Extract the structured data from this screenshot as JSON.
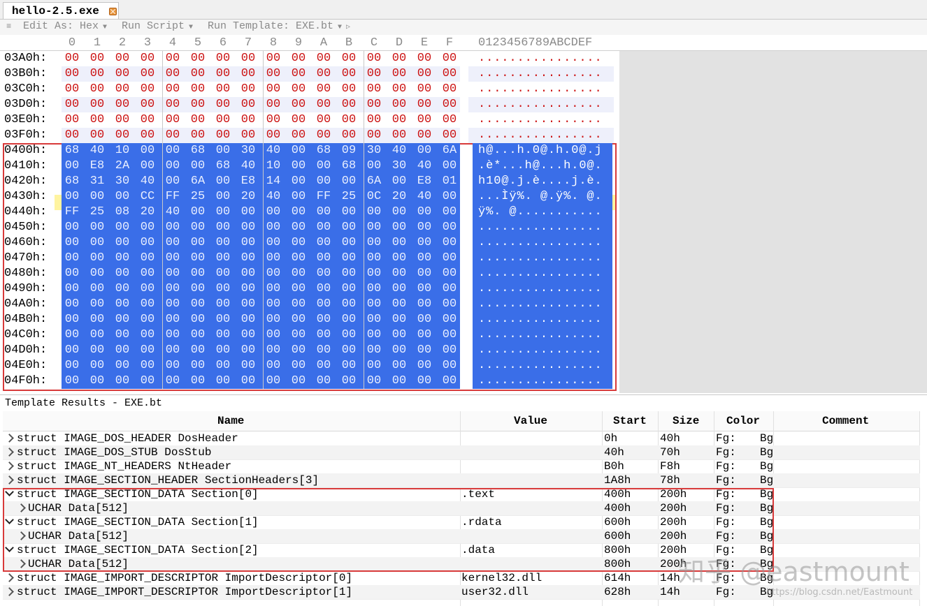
{
  "tab": {
    "label": "hello-2.5.exe"
  },
  "toolbar": {
    "edit_as": "Edit As: Hex",
    "run_script": "Run Script",
    "run_template": "Run Template: EXE.bt"
  },
  "hex": {
    "col_headers": [
      "0",
      "1",
      "2",
      "3",
      "4",
      "5",
      "6",
      "7",
      "8",
      "9",
      "A",
      "B",
      "C",
      "D",
      "E",
      "F"
    ],
    "ascii_header": "0123456789ABCDEF",
    "rows": [
      {
        "offset": "03A0h:",
        "bytes": [
          "00",
          "00",
          "00",
          "00",
          "00",
          "00",
          "00",
          "00",
          "00",
          "00",
          "00",
          "00",
          "00",
          "00",
          "00",
          "00"
        ],
        "ascii": "................",
        "selected": false
      },
      {
        "offset": "03B0h:",
        "bytes": [
          "00",
          "00",
          "00",
          "00",
          "00",
          "00",
          "00",
          "00",
          "00",
          "00",
          "00",
          "00",
          "00",
          "00",
          "00",
          "00"
        ],
        "ascii": "................",
        "selected": false
      },
      {
        "offset": "03C0h:",
        "bytes": [
          "00",
          "00",
          "00",
          "00",
          "00",
          "00",
          "00",
          "00",
          "00",
          "00",
          "00",
          "00",
          "00",
          "00",
          "00",
          "00"
        ],
        "ascii": "................",
        "selected": false
      },
      {
        "offset": "03D0h:",
        "bytes": [
          "00",
          "00",
          "00",
          "00",
          "00",
          "00",
          "00",
          "00",
          "00",
          "00",
          "00",
          "00",
          "00",
          "00",
          "00",
          "00"
        ],
        "ascii": "................",
        "selected": false
      },
      {
        "offset": "03E0h:",
        "bytes": [
          "00",
          "00",
          "00",
          "00",
          "00",
          "00",
          "00",
          "00",
          "00",
          "00",
          "00",
          "00",
          "00",
          "00",
          "00",
          "00"
        ],
        "ascii": "................",
        "selected": false
      },
      {
        "offset": "03F0h:",
        "bytes": [
          "00",
          "00",
          "00",
          "00",
          "00",
          "00",
          "00",
          "00",
          "00",
          "00",
          "00",
          "00",
          "00",
          "00",
          "00",
          "00"
        ],
        "ascii": "................",
        "selected": false
      },
      {
        "offset": "0400h:",
        "bytes": [
          "68",
          "40",
          "10",
          "00",
          "00",
          "68",
          "00",
          "30",
          "40",
          "00",
          "68",
          "09",
          "30",
          "40",
          "00",
          "6A"
        ],
        "ascii": "h@...h.0@.h.0@.j",
        "selected": true
      },
      {
        "offset": "0410h:",
        "bytes": [
          "00",
          "E8",
          "2A",
          "00",
          "00",
          "00",
          "68",
          "40",
          "10",
          "00",
          "00",
          "68",
          "00",
          "30",
          "40",
          "00"
        ],
        "ascii": ".è*...h@...h.0@.",
        "selected": true
      },
      {
        "offset": "0420h:",
        "bytes": [
          "68",
          "31",
          "30",
          "40",
          "00",
          "6A",
          "00",
          "E8",
          "14",
          "00",
          "00",
          "00",
          "6A",
          "00",
          "E8",
          "01"
        ],
        "ascii": "h10@.j.è....j.è.",
        "selected": true
      },
      {
        "offset": "0430h:",
        "bytes": [
          "00",
          "00",
          "00",
          "CC",
          "FF",
          "25",
          "00",
          "20",
          "40",
          "00",
          "FF",
          "25",
          "0C",
          "20",
          "40",
          "00"
        ],
        "ascii": "...Ìÿ%. @.ÿ%. @.",
        "selected": true
      },
      {
        "offset": "0440h:",
        "bytes": [
          "FF",
          "25",
          "08",
          "20",
          "40",
          "00",
          "00",
          "00",
          "00",
          "00",
          "00",
          "00",
          "00",
          "00",
          "00",
          "00"
        ],
        "ascii": "ÿ%. @...........",
        "selected": true
      },
      {
        "offset": "0450h:",
        "bytes": [
          "00",
          "00",
          "00",
          "00",
          "00",
          "00",
          "00",
          "00",
          "00",
          "00",
          "00",
          "00",
          "00",
          "00",
          "00",
          "00"
        ],
        "ascii": "................",
        "selected": true
      },
      {
        "offset": "0460h:",
        "bytes": [
          "00",
          "00",
          "00",
          "00",
          "00",
          "00",
          "00",
          "00",
          "00",
          "00",
          "00",
          "00",
          "00",
          "00",
          "00",
          "00"
        ],
        "ascii": "................",
        "selected": true
      },
      {
        "offset": "0470h:",
        "bytes": [
          "00",
          "00",
          "00",
          "00",
          "00",
          "00",
          "00",
          "00",
          "00",
          "00",
          "00",
          "00",
          "00",
          "00",
          "00",
          "00"
        ],
        "ascii": "................",
        "selected": true
      },
      {
        "offset": "0480h:",
        "bytes": [
          "00",
          "00",
          "00",
          "00",
          "00",
          "00",
          "00",
          "00",
          "00",
          "00",
          "00",
          "00",
          "00",
          "00",
          "00",
          "00"
        ],
        "ascii": "................",
        "selected": true
      },
      {
        "offset": "0490h:",
        "bytes": [
          "00",
          "00",
          "00",
          "00",
          "00",
          "00",
          "00",
          "00",
          "00",
          "00",
          "00",
          "00",
          "00",
          "00",
          "00",
          "00"
        ],
        "ascii": "................",
        "selected": true
      },
      {
        "offset": "04A0h:",
        "bytes": [
          "00",
          "00",
          "00",
          "00",
          "00",
          "00",
          "00",
          "00",
          "00",
          "00",
          "00",
          "00",
          "00",
          "00",
          "00",
          "00"
        ],
        "ascii": "................",
        "selected": true
      },
      {
        "offset": "04B0h:",
        "bytes": [
          "00",
          "00",
          "00",
          "00",
          "00",
          "00",
          "00",
          "00",
          "00",
          "00",
          "00",
          "00",
          "00",
          "00",
          "00",
          "00"
        ],
        "ascii": "................",
        "selected": true
      },
      {
        "offset": "04C0h:",
        "bytes": [
          "00",
          "00",
          "00",
          "00",
          "00",
          "00",
          "00",
          "00",
          "00",
          "00",
          "00",
          "00",
          "00",
          "00",
          "00",
          "00"
        ],
        "ascii": "................",
        "selected": true
      },
      {
        "offset": "04D0h:",
        "bytes": [
          "00",
          "00",
          "00",
          "00",
          "00",
          "00",
          "00",
          "00",
          "00",
          "00",
          "00",
          "00",
          "00",
          "00",
          "00",
          "00"
        ],
        "ascii": "................",
        "selected": true
      },
      {
        "offset": "04E0h:",
        "bytes": [
          "00",
          "00",
          "00",
          "00",
          "00",
          "00",
          "00",
          "00",
          "00",
          "00",
          "00",
          "00",
          "00",
          "00",
          "00",
          "00"
        ],
        "ascii": "................",
        "selected": true
      },
      {
        "offset": "04F0h:",
        "bytes": [
          "00",
          "00",
          "00",
          "00",
          "00",
          "00",
          "00",
          "00",
          "00",
          "00",
          "00",
          "00",
          "00",
          "00",
          "00",
          "00"
        ],
        "ascii": "................",
        "selected": true
      }
    ]
  },
  "template_results": {
    "title": "Template Results - EXE.bt",
    "columns": {
      "name": "Name",
      "value": "Value",
      "start": "Start",
      "size": "Size",
      "color": "Color",
      "comment": "Comment"
    },
    "rows": [
      {
        "name": "struct IMAGE_DOS_HEADER DosHeader",
        "value": "",
        "start": "0h",
        "size": "40h",
        "fg": "Fg:",
        "bg": "Bg",
        "indent": 0,
        "expanded": false
      },
      {
        "name": "struct IMAGE_DOS_STUB DosStub",
        "value": "",
        "start": "40h",
        "size": "70h",
        "fg": "Fg:",
        "bg": "Bg",
        "indent": 0,
        "expanded": false
      },
      {
        "name": "struct IMAGE_NT_HEADERS NtHeader",
        "value": "",
        "start": "B0h",
        "size": "F8h",
        "fg": "Fg:",
        "bg": "Bg",
        "indent": 0,
        "expanded": false
      },
      {
        "name": "struct IMAGE_SECTION_HEADER SectionHeaders[3]",
        "value": "",
        "start": "1A8h",
        "size": "78h",
        "fg": "Fg:",
        "bg": "Bg",
        "indent": 0,
        "expanded": false
      },
      {
        "name": "struct IMAGE_SECTION_DATA Section[0]",
        "value": ".text",
        "start": "400h",
        "size": "200h",
        "fg": "Fg:",
        "bg": "Bg",
        "indent": 0,
        "expanded": true
      },
      {
        "name": "UCHAR Data[512]",
        "value": "",
        "start": "400h",
        "size": "200h",
        "fg": "Fg:",
        "bg": "Bg",
        "indent": 1,
        "expanded": false
      },
      {
        "name": "struct IMAGE_SECTION_DATA Section[1]",
        "value": ".rdata",
        "start": "600h",
        "size": "200h",
        "fg": "Fg:",
        "bg": "Bg",
        "indent": 0,
        "expanded": true
      },
      {
        "name": "UCHAR Data[512]",
        "value": "",
        "start": "600h",
        "size": "200h",
        "fg": "Fg:",
        "bg": "Bg",
        "indent": 1,
        "expanded": false
      },
      {
        "name": "struct IMAGE_SECTION_DATA Section[2]",
        "value": ".data",
        "start": "800h",
        "size": "200h",
        "fg": "Fg:",
        "bg": "Bg",
        "indent": 0,
        "expanded": true
      },
      {
        "name": "UCHAR Data[512]",
        "value": "",
        "start": "800h",
        "size": "200h",
        "fg": "Fg:",
        "bg": "Bg",
        "indent": 1,
        "expanded": false
      },
      {
        "name": "struct IMAGE_IMPORT_DESCRIPTOR ImportDescriptor[0]",
        "value": "kernel32.dll",
        "start": "614h",
        "size": "14h",
        "fg": "Fg:",
        "bg": "Bg",
        "indent": 0,
        "expanded": false
      },
      {
        "name": "struct IMAGE_IMPORT_DESCRIPTOR ImportDescriptor[1]",
        "value": "user32.dll",
        "start": "628h",
        "size": "14h",
        "fg": "Fg:",
        "bg": "Bg",
        "indent": 0,
        "expanded": false
      }
    ]
  },
  "watermark": {
    "main": "知乎 @eastmount",
    "url": "https://blog.csdn.net/Eastmount"
  },
  "colors": {
    "selection": "#3a6ee8",
    "byte_text": "#cc1111",
    "highlight_box": "#d83a3a"
  },
  "icons": {
    "tab_close": "close-icon",
    "toolbar_collapse": "chevron-down-icon",
    "tree_expand": "chevron-right-icon"
  }
}
